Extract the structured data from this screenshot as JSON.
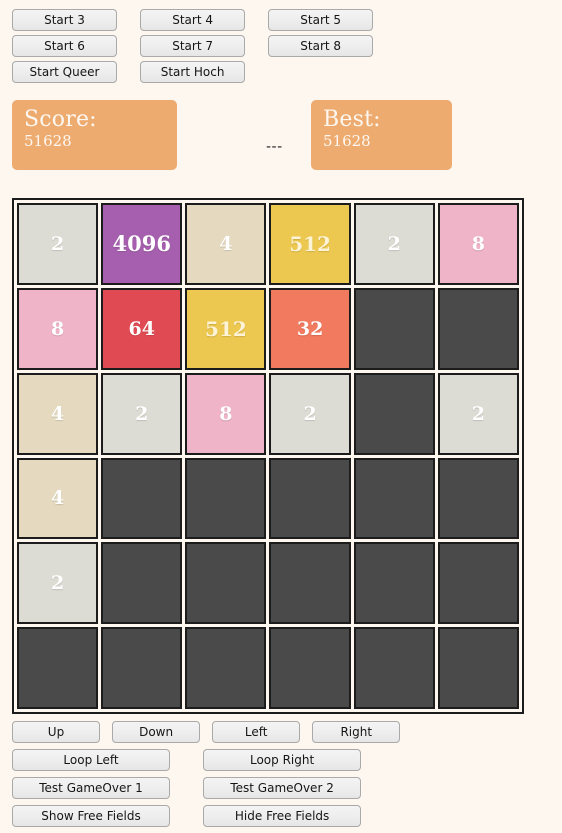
{
  "start_buttons": [
    [
      {
        "label": "Start 3"
      },
      {
        "label": "Start 4"
      },
      {
        "label": "Start 5"
      }
    ],
    [
      {
        "label": "Start 6"
      },
      {
        "label": "Start 7"
      },
      {
        "label": "Start 8"
      }
    ],
    [
      {
        "label": "Start Queer"
      },
      {
        "label": "Start Hoch"
      }
    ]
  ],
  "score": {
    "score_label": "Score:",
    "score_value": "51628",
    "best_label": "Best:",
    "best_value": "51628",
    "separator": "---",
    "box_color": "#edab70"
  },
  "board": {
    "rows": 6,
    "cols": 6,
    "empty_color": "#4a4a4a",
    "grid": [
      [
        2,
        4096,
        4,
        512,
        2,
        8
      ],
      [
        8,
        64,
        512,
        32,
        0,
        0
      ],
      [
        4,
        2,
        8,
        2,
        0,
        2
      ],
      [
        4,
        0,
        0,
        0,
        0,
        0
      ],
      [
        2,
        0,
        0,
        0,
        0,
        0
      ],
      [
        0,
        0,
        0,
        0,
        0,
        0
      ]
    ],
    "tile_colors": {
      "2": "#dcdcd4",
      "4": "#e5dac0",
      "8": "#f0b4c8",
      "32": "#f27a5f",
      "64": "#e04b53",
      "512": "#edc850",
      "4096": "#a65fae"
    }
  },
  "controls": {
    "arrows": [
      {
        "label": "Up"
      },
      {
        "label": "Down"
      },
      {
        "label": "Left"
      },
      {
        "label": "Right"
      }
    ],
    "pairs": [
      [
        {
          "label": "Loop Left"
        },
        {
          "label": "Loop Right"
        }
      ],
      [
        {
          "label": "Test GameOver 1"
        },
        {
          "label": "Test GameOver 2"
        }
      ],
      [
        {
          "label": "Show Free Fields"
        },
        {
          "label": "Hide Free Fields"
        }
      ]
    ]
  }
}
